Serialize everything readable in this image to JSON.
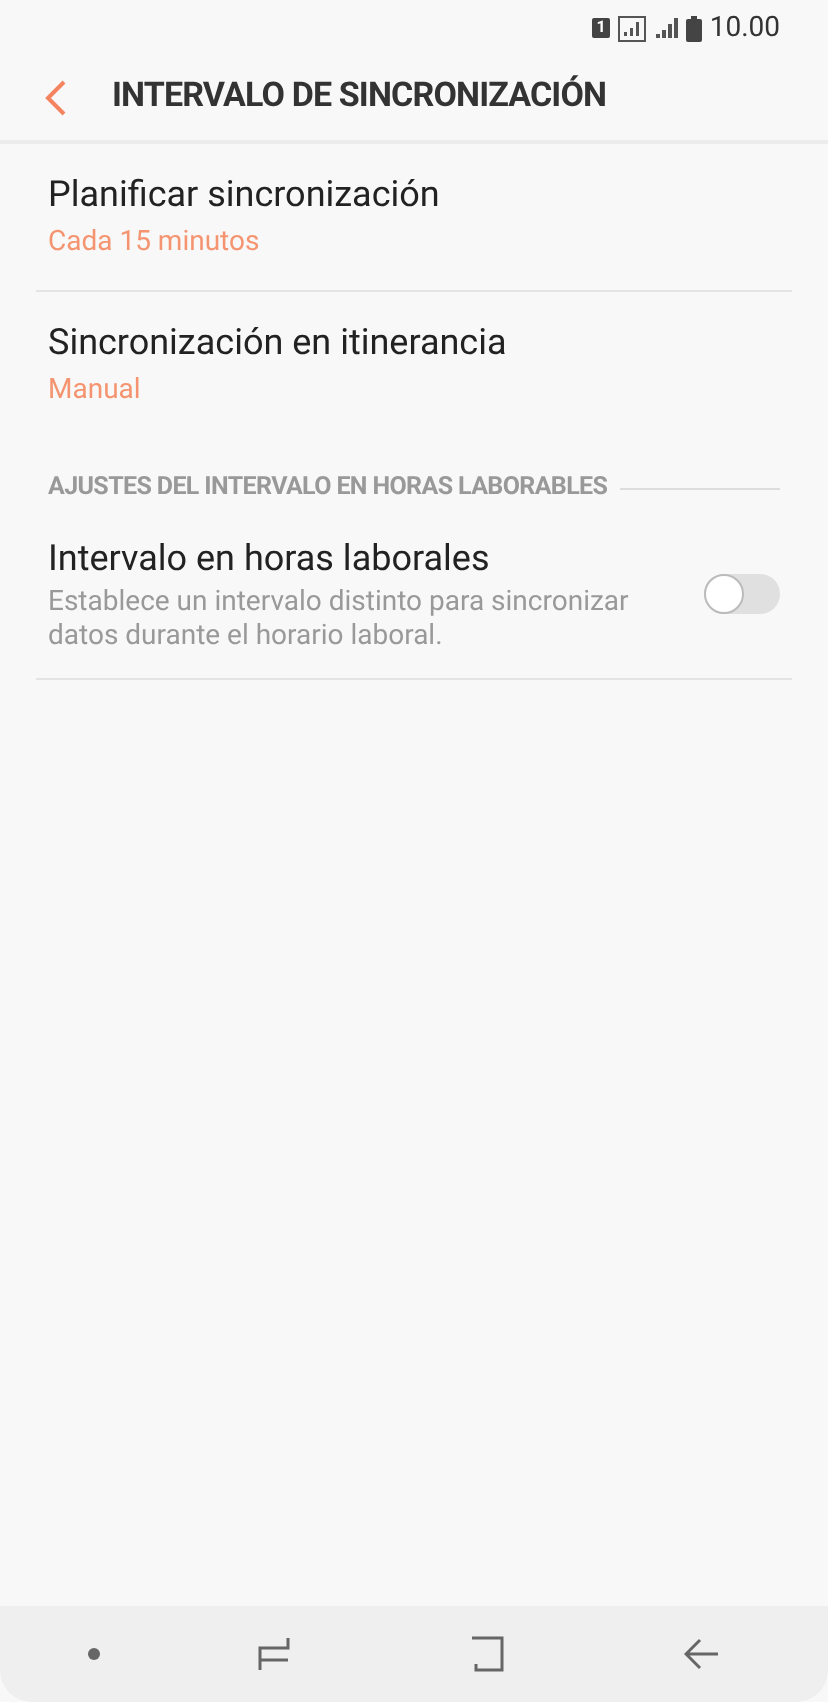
{
  "status_bar": {
    "sim": "1",
    "time": "10.00"
  },
  "header": {
    "title": "INTERVALO DE SINCRONIZACIÓN"
  },
  "items": [
    {
      "title": "Planificar sincronización",
      "value": "Cada 15 minutos"
    },
    {
      "title": "Sincronización en itinerancia",
      "value": "Manual"
    }
  ],
  "section": {
    "title": "AJUSTES DEL INTERVALO EN HORAS LABORABLES"
  },
  "toggle_item": {
    "title": "Intervalo en horas laborales",
    "description": "Establece un intervalo distinto para sincronizar datos durante el horario laboral.",
    "on": false
  }
}
